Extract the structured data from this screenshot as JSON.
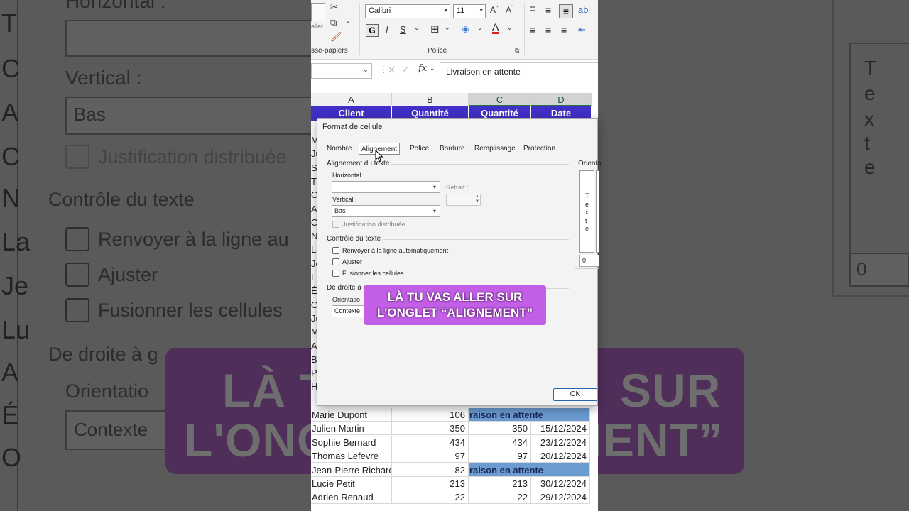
{
  "background": {
    "texts": {
      "horizontal": "Horizontal :",
      "vertical": "Vertical :",
      "vertical_value": "Bas",
      "justification": "Justification distribuée",
      "controle": "Contrôle du texte",
      "renvoyer": "Renvoyer à la ligne au",
      "ajuster": "Ajuster",
      "fusionner": "Fusionner les cellules",
      "droite": "De droite à g",
      "orientation": "Orientatio",
      "contexte": "Contexte",
      "retrait_value": "0",
      "texte_vertical": [
        "T",
        "e",
        "x",
        "t",
        "e"
      ],
      "left_letters": [
        "T",
        "C",
        "A",
        "C",
        "N",
        "La",
        "Je",
        "Lu",
        "A",
        "É",
        "O"
      ]
    },
    "banner_fragments": {
      "l1_left": "LÀ T",
      "l1_right": "SUR",
      "l2_left": "L'ONG",
      "l2_right": "MENT”"
    }
  },
  "ribbon": {
    "font_name": "Calibri",
    "font_size": "11",
    "bold": "G",
    "italic": "I",
    "underline": "S",
    "clipboard_label": "sse-papiers",
    "clipboard_small": "aller",
    "police_label": "Police"
  },
  "formula_bar": {
    "fx": "fx",
    "content": "Livraison en attente"
  },
  "grid": {
    "columns": [
      "A",
      "B",
      "C",
      "D"
    ],
    "header_row": [
      "Client",
      "Quantité",
      "Quantité",
      "Date"
    ],
    "left_letters": [
      "M",
      "Ju",
      "S",
      "T",
      "C",
      "A",
      "C",
      "N",
      "La",
      "Je",
      "Lu",
      "É",
      "O",
      "Ju",
      "M",
      "A",
      "B",
      "P",
      "H"
    ],
    "rows": [
      {
        "name": "Marie Dupont",
        "qty": "106",
        "qty2": "",
        "date": "",
        "status": "raison en attente"
      },
      {
        "name": "Julien Martin",
        "qty": "350",
        "qty2": "350",
        "date": "15/12/2024",
        "status": ""
      },
      {
        "name": "Sophie Bernard",
        "qty": "434",
        "qty2": "434",
        "date": "23/12/2024",
        "status": ""
      },
      {
        "name": "Thomas Lefevre",
        "qty": "97",
        "qty2": "97",
        "date": "20/12/2024",
        "status": ""
      },
      {
        "name": "Jean-Pierre Richard",
        "qty": "82",
        "qty2": "",
        "date": "",
        "status": "raison en attente"
      },
      {
        "name": "Lucie Petit",
        "qty": "213",
        "qty2": "213",
        "date": "30/12/2024",
        "status": ""
      },
      {
        "name": "Adrien Renaud",
        "qty": "22",
        "qty2": "22",
        "date": "29/12/2024",
        "status": ""
      }
    ]
  },
  "dialog": {
    "title": "Format de cellule",
    "tabs": [
      "Nombre",
      "Alignement",
      "Police",
      "Bordure",
      "Remplissage",
      "Protection"
    ],
    "active_tab": "Alignement",
    "alignement_section": "Alignement du texte",
    "horizontal_label": "Horizontal :",
    "horizontal_value": "",
    "retrait_label": "Retrait :",
    "retrait_value": "",
    "vertical_label": "Vertical :",
    "vertical_value": "Bas",
    "justification_label": "Justification distribuée",
    "controle_section": "Contrôle du texte",
    "renvoyer_label": "Renvoyer à la ligne automatiquement",
    "ajuster_label": "Ajuster",
    "fusionner_label": "Fusionner les cellules",
    "droite_section": "De droite à g",
    "orientation_label": "Orientatio",
    "contexte_value": "Contexte",
    "orientation_section": "Orienta",
    "texte_vertical": [
      "T",
      "e",
      "x",
      "t",
      "e"
    ],
    "degrees_value": "0",
    "ok_label": "OK"
  },
  "caption": {
    "line1": "LÀ TU VAS ALLER SUR",
    "line2": "L'ONGLET “ALIGNEMENT”"
  }
}
